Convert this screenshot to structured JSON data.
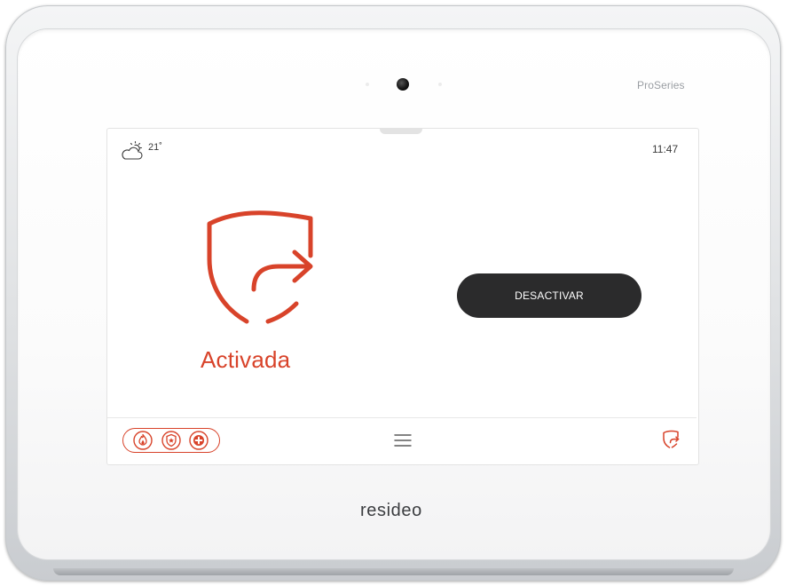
{
  "device": {
    "series_label": "ProSeries",
    "brand_logo": "resideo"
  },
  "status_bar": {
    "weather_icon": "partly-cloudy-icon",
    "temperature": "21˚",
    "time": "11:47"
  },
  "main": {
    "status_icon": "shield-armed-away-icon",
    "status_label": "Activada",
    "disarm_button_label": "DESACTIVAR"
  },
  "bottom_bar": {
    "emergency_buttons": [
      {
        "name": "fire",
        "icon": "flame-icon"
      },
      {
        "name": "police",
        "icon": "police-badge-icon"
      },
      {
        "name": "medical",
        "icon": "medical-cross-icon"
      }
    ],
    "menu_icon": "hamburger-menu-icon",
    "arm_status_icon": "shield-arm-away-icon"
  },
  "colors": {
    "accent": "#d8432a",
    "button_bg": "#2b2b2c",
    "text": "#3a3a3a",
    "bezel": "#dfe1e3"
  }
}
